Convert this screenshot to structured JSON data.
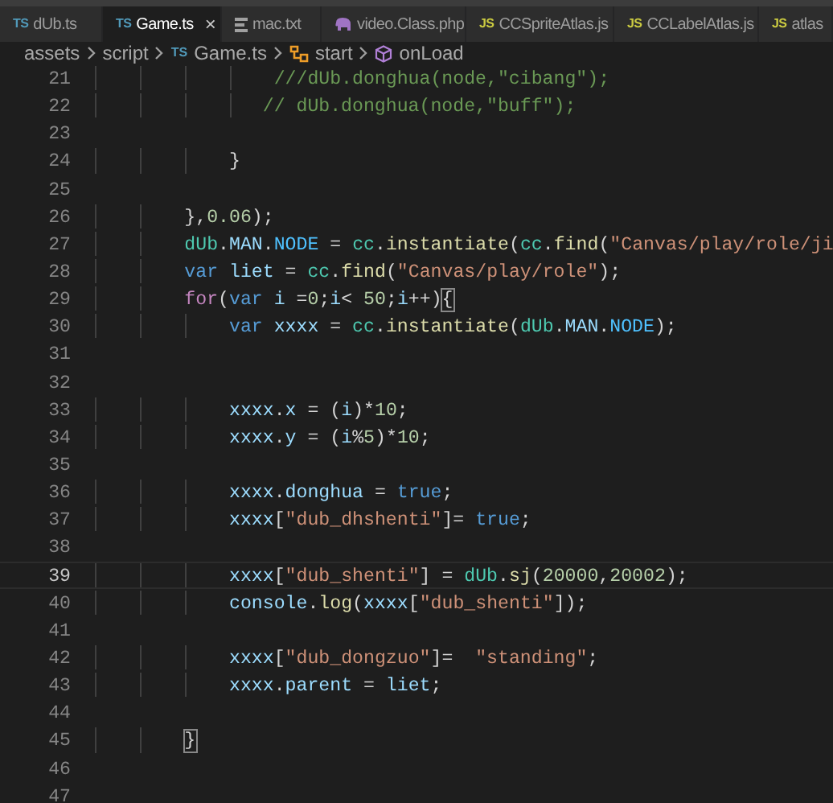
{
  "tabs": [
    {
      "label": "dUb.ts",
      "kind": "ts",
      "badge": "TS",
      "selected": false
    },
    {
      "label": "Game.ts",
      "kind": "ts",
      "badge": "TS",
      "selected": true,
      "close": "×"
    },
    {
      "label": "mac.txt",
      "kind": "txt",
      "selected": false
    },
    {
      "label": "video.Class.php",
      "kind": "php",
      "selected": false
    },
    {
      "label": "CCSpriteAtlas.js",
      "kind": "js",
      "badge": "JS",
      "selected": false
    },
    {
      "label": "CCLabelAtlas.js",
      "kind": "js",
      "badge": "JS",
      "selected": false
    },
    {
      "label": "atlas",
      "kind": "js",
      "badge": "JS",
      "selected": false
    }
  ],
  "breadcrumb": [
    {
      "label": "assets",
      "kind": "folder"
    },
    {
      "label": "script",
      "kind": "folder"
    },
    {
      "label": "Game.ts",
      "kind": "ts",
      "badge": "TS"
    },
    {
      "label": "start",
      "kind": "method"
    },
    {
      "label": "onLoad",
      "kind": "function"
    }
  ],
  "lines": [
    {
      "n": "21",
      "current": false,
      "tokens": [
        {
          "t": "                ///dUb.donghua(node,\"cibang\");",
          "kind": "comment"
        }
      ]
    },
    {
      "n": "22",
      "current": false,
      "tokens": [
        {
          "t": "               // dUb.donghua(node,\"buff\");",
          "kind": "comment"
        }
      ]
    },
    {
      "n": "23",
      "current": false
    },
    {
      "n": "24",
      "current": false,
      "tokens": [
        {
          "t": "            }",
          "kind": "plain"
        }
      ]
    },
    {
      "n": "25",
      "current": false
    },
    {
      "n": "26",
      "current": false,
      "tokens": [
        {
          "t": "        },",
          "kind": "plain"
        },
        {
          "t": "0.06",
          "kind": "number"
        },
        {
          "t": ");",
          "kind": "plain"
        }
      ]
    },
    {
      "n": "27",
      "current": false,
      "tokens": [
        {
          "t": "        dUb",
          "kind": "class"
        },
        {
          "t": ".",
          "kind": "plain"
        },
        {
          "t": "MAN",
          "kind": "var"
        },
        {
          "t": ".",
          "kind": "plain"
        },
        {
          "t": "NODE",
          "kind": "const"
        },
        {
          "t": " = ",
          "kind": "plain"
        },
        {
          "t": "cc",
          "kind": "class"
        },
        {
          "t": ".",
          "kind": "plain"
        },
        {
          "t": "instantiate",
          "kind": "func"
        },
        {
          "t": "(",
          "kind": "plain"
        },
        {
          "t": "cc",
          "kind": "class"
        },
        {
          "t": ".",
          "kind": "plain"
        },
        {
          "t": "find",
          "kind": "func"
        },
        {
          "t": "(",
          "kind": "plain"
        },
        {
          "t": "\"Canvas/play/role/ji",
          "kind": "string"
        }
      ]
    },
    {
      "n": "28",
      "current": false,
      "tokens": [
        {
          "t": "        var",
          "kind": "keyword"
        },
        {
          "t": " liet",
          "kind": "var"
        },
        {
          "t": " = ",
          "kind": "plain"
        },
        {
          "t": "cc",
          "kind": "class"
        },
        {
          "t": ".",
          "kind": "plain"
        },
        {
          "t": "find",
          "kind": "func"
        },
        {
          "t": "(",
          "kind": "plain"
        },
        {
          "t": "\"Canvas/play/role\"",
          "kind": "string"
        },
        {
          "t": ");",
          "kind": "plain"
        }
      ]
    },
    {
      "n": "29",
      "current": false,
      "tokens": [
        {
          "t": "        for",
          "kind": "control"
        },
        {
          "t": "(",
          "kind": "plain"
        },
        {
          "t": "var",
          "kind": "keyword"
        },
        {
          "t": " i",
          "kind": "var"
        },
        {
          "t": " =",
          "kind": "plain"
        },
        {
          "t": "0",
          "kind": "number"
        },
        {
          "t": ";",
          "kind": "plain"
        },
        {
          "t": "i",
          "kind": "var"
        },
        {
          "t": "< ",
          "kind": "plain"
        },
        {
          "t": "50",
          "kind": "number"
        },
        {
          "t": ";",
          "kind": "plain"
        },
        {
          "t": "i",
          "kind": "var"
        },
        {
          "t": "++)",
          "kind": "plain"
        },
        {
          "t": "{",
          "kind": "bracket"
        }
      ]
    },
    {
      "n": "30",
      "current": false,
      "tokens": [
        {
          "t": "            var",
          "kind": "keyword"
        },
        {
          "t": " xxxx",
          "kind": "var"
        },
        {
          "t": " = ",
          "kind": "plain"
        },
        {
          "t": "cc",
          "kind": "class"
        },
        {
          "t": ".",
          "kind": "plain"
        },
        {
          "t": "instantiate",
          "kind": "func"
        },
        {
          "t": "(",
          "kind": "plain"
        },
        {
          "t": "dUb",
          "kind": "class"
        },
        {
          "t": ".",
          "kind": "plain"
        },
        {
          "t": "MAN",
          "kind": "var"
        },
        {
          "t": ".",
          "kind": "plain"
        },
        {
          "t": "NODE",
          "kind": "const"
        },
        {
          "t": ");",
          "kind": "plain"
        }
      ]
    },
    {
      "n": "31",
      "current": false
    },
    {
      "n": "32",
      "current": false
    },
    {
      "n": "33",
      "current": false,
      "tokens": [
        {
          "t": "            xxxx",
          "kind": "var"
        },
        {
          "t": ".",
          "kind": "plain"
        },
        {
          "t": "x",
          "kind": "var"
        },
        {
          "t": " = (",
          "kind": "plain"
        },
        {
          "t": "i",
          "kind": "var"
        },
        {
          "t": ")*",
          "kind": "plain"
        },
        {
          "t": "10",
          "kind": "number"
        },
        {
          "t": ";",
          "kind": "plain"
        }
      ]
    },
    {
      "n": "34",
      "current": false,
      "tokens": [
        {
          "t": "            xxxx",
          "kind": "var"
        },
        {
          "t": ".",
          "kind": "plain"
        },
        {
          "t": "y",
          "kind": "var"
        },
        {
          "t": " = (",
          "kind": "plain"
        },
        {
          "t": "i",
          "kind": "var"
        },
        {
          "t": "%",
          "kind": "plain"
        },
        {
          "t": "5",
          "kind": "number"
        },
        {
          "t": ")*",
          "kind": "plain"
        },
        {
          "t": "10",
          "kind": "number"
        },
        {
          "t": ";",
          "kind": "plain"
        }
      ]
    },
    {
      "n": "35",
      "current": false
    },
    {
      "n": "36",
      "current": false,
      "tokens": [
        {
          "t": "            xxxx",
          "kind": "var"
        },
        {
          "t": ".",
          "kind": "plain"
        },
        {
          "t": "donghua",
          "kind": "var"
        },
        {
          "t": " = ",
          "kind": "plain"
        },
        {
          "t": "true",
          "kind": "keyword"
        },
        {
          "t": ";",
          "kind": "plain"
        }
      ]
    },
    {
      "n": "37",
      "current": false,
      "tokens": [
        {
          "t": "            xxxx",
          "kind": "var"
        },
        {
          "t": "[",
          "kind": "plain"
        },
        {
          "t": "\"dub_dhshenti\"",
          "kind": "string"
        },
        {
          "t": "]= ",
          "kind": "plain"
        },
        {
          "t": "true",
          "kind": "keyword"
        },
        {
          "t": ";",
          "kind": "plain"
        }
      ]
    },
    {
      "n": "38",
      "current": false
    },
    {
      "n": "39",
      "current": true,
      "tokens": [
        {
          "t": "            xxxx",
          "kind": "var"
        },
        {
          "t": "[",
          "kind": "plain"
        },
        {
          "t": "\"dub_shenti\"",
          "kind": "string"
        },
        {
          "t": "] = ",
          "kind": "plain"
        },
        {
          "t": "dUb",
          "kind": "class"
        },
        {
          "t": ".",
          "kind": "plain"
        },
        {
          "t": "sj",
          "kind": "func"
        },
        {
          "t": "(",
          "kind": "plain"
        },
        {
          "t": "20000",
          "kind": "number"
        },
        {
          "t": ",",
          "kind": "plain"
        },
        {
          "t": "20002",
          "kind": "number"
        },
        {
          "t": ");",
          "kind": "plain"
        }
      ]
    },
    {
      "n": "40",
      "current": false,
      "tokens": [
        {
          "t": "            console",
          "kind": "var"
        },
        {
          "t": ".",
          "kind": "plain"
        },
        {
          "t": "log",
          "kind": "func"
        },
        {
          "t": "(",
          "kind": "plain"
        },
        {
          "t": "xxxx",
          "kind": "var"
        },
        {
          "t": "[",
          "kind": "plain"
        },
        {
          "t": "\"dub_shenti\"",
          "kind": "string"
        },
        {
          "t": "]);",
          "kind": "plain"
        }
      ]
    },
    {
      "n": "41",
      "current": false
    },
    {
      "n": "42",
      "current": false,
      "tokens": [
        {
          "t": "            xxxx",
          "kind": "var"
        },
        {
          "t": "[",
          "kind": "plain"
        },
        {
          "t": "\"dub_dongzuo\"",
          "kind": "string"
        },
        {
          "t": "]=  ",
          "kind": "plain"
        },
        {
          "t": "\"standing\"",
          "kind": "string"
        },
        {
          "t": ";",
          "kind": "plain"
        }
      ]
    },
    {
      "n": "43",
      "current": false,
      "tokens": [
        {
          "t": "            xxxx",
          "kind": "var"
        },
        {
          "t": ".",
          "kind": "plain"
        },
        {
          "t": "parent",
          "kind": "var"
        },
        {
          "t": " = ",
          "kind": "plain"
        },
        {
          "t": "liet",
          "kind": "var"
        },
        {
          "t": ";",
          "kind": "plain"
        }
      ]
    },
    {
      "n": "44",
      "current": false
    },
    {
      "n": "45",
      "current": false,
      "tokens": [
        {
          "t": "        }",
          "kind": "bracket"
        }
      ]
    },
    {
      "n": "46",
      "current": false
    },
    {
      "n": "47",
      "current": false
    }
  ]
}
